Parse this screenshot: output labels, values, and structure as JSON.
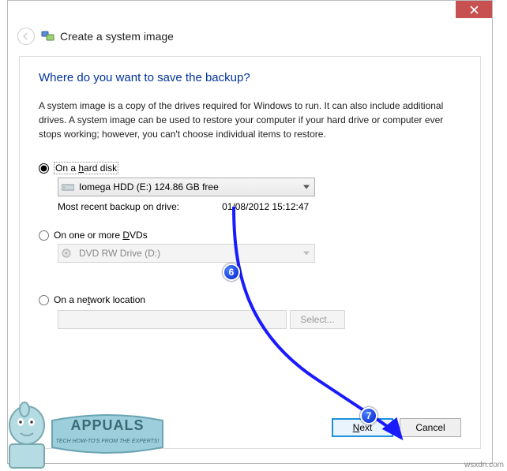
{
  "window": {
    "title": "Create a system image"
  },
  "page": {
    "heading": "Where do you want to save the backup?",
    "description": "A system image is a copy of the drives required for Windows to run. It can also include additional drives. A system image can be used to restore your computer if your hard drive or computer ever stops working; however, you can't choose individual items to restore."
  },
  "options": {
    "hard_disk": {
      "label_pre": "On a ",
      "label_u": "h",
      "label_post": "ard disk",
      "selected_drive": "Iomega HDD (E:)  124.86 GB free",
      "info_label": "Most recent backup on drive:",
      "info_value": "01/08/2012 15:12:47"
    },
    "dvd": {
      "label_pre": "On one or more ",
      "label_u": "D",
      "label_post": "VDs",
      "selected_drive": "DVD RW Drive (D:)"
    },
    "network": {
      "label_pre": "On a ne",
      "label_u": "t",
      "label_post": "work location",
      "select_btn": "Select..."
    }
  },
  "buttons": {
    "next_u": "N",
    "next_rest": "ext",
    "cancel": "Cancel"
  },
  "annotations": {
    "badge6": "6",
    "badge7": "7"
  },
  "branding": {
    "logo_main": "APPUALS",
    "logo_sub": "TECH HOW-TO'S FROM THE EXPERTS!",
    "watermark": "wsxdn.com"
  }
}
